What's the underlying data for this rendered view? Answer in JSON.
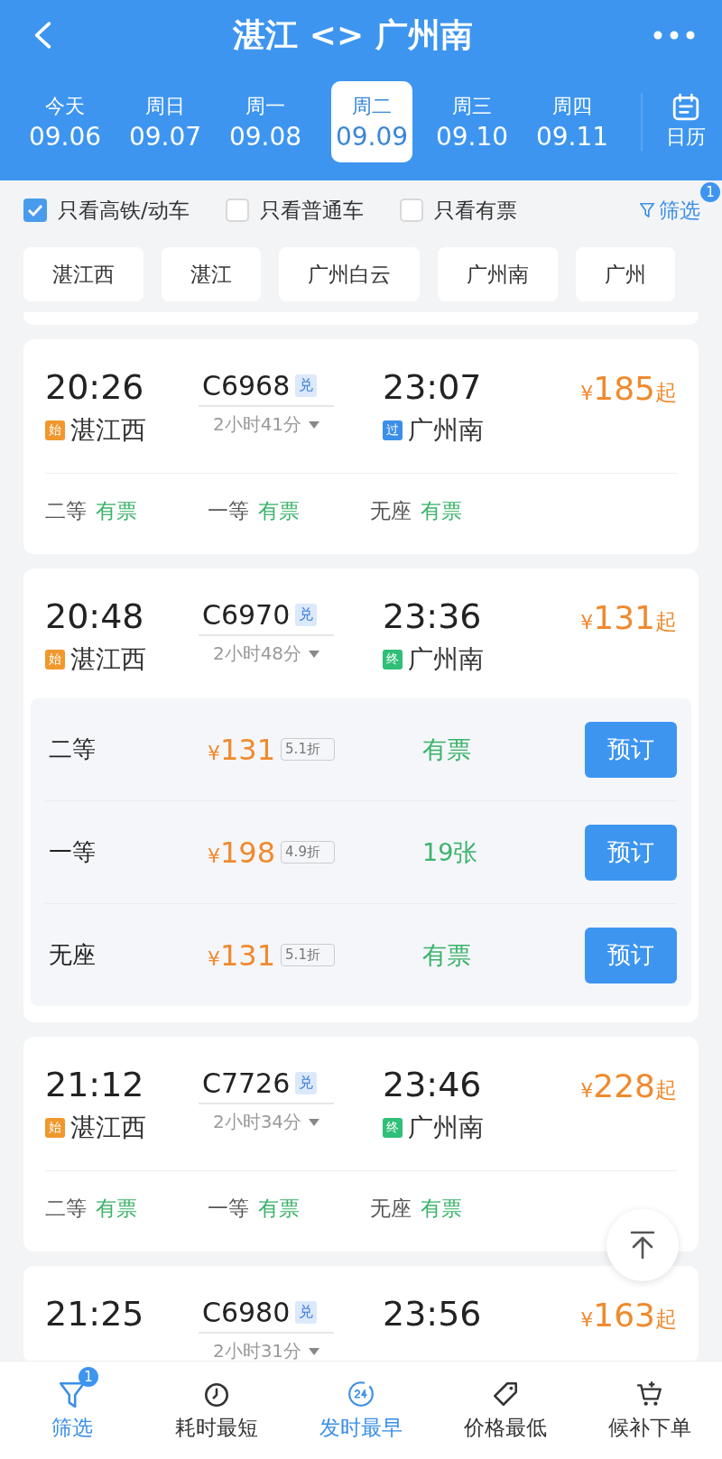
{
  "header": {
    "title": "湛江 <> 广州南"
  },
  "dates": [
    {
      "weekday": "今天",
      "date": "09.06",
      "selected": false
    },
    {
      "weekday": "周日",
      "date": "09.07",
      "selected": false
    },
    {
      "weekday": "周一",
      "date": "09.08",
      "selected": false
    },
    {
      "weekday": "周二",
      "date": "09.09",
      "selected": true
    },
    {
      "weekday": "周三",
      "date": "09.10",
      "selected": false
    },
    {
      "weekday": "周四",
      "date": "09.11",
      "selected": false
    }
  ],
  "calendar": {
    "label": "日历"
  },
  "filters": [
    {
      "label": "只看高铁/动车",
      "checked": true
    },
    {
      "label": "只看普通车",
      "checked": false
    },
    {
      "label": "只看有票",
      "checked": false
    }
  ],
  "filter_button": {
    "label": "筛选",
    "badge": "1"
  },
  "stations": [
    {
      "label": "湛江西"
    },
    {
      "label": "湛江"
    },
    {
      "label": "广州白云"
    },
    {
      "label": "广州南"
    },
    {
      "label": "广州"
    }
  ],
  "trains": [
    {
      "depart_time": "20:26",
      "from": {
        "tag": "始",
        "color": "#f0982e",
        "station": "湛江西"
      },
      "train_no": "C6968",
      "tag": "兑",
      "duration": "2小时41分",
      "arrive_time": "23:07",
      "to": {
        "tag": "过",
        "color": "#3b8fe8",
        "station": "广州南"
      },
      "currency": "¥",
      "price": "185",
      "suffix": "起",
      "expanded": false,
      "seats": [
        {
          "class": "二等",
          "availability": "有票"
        },
        {
          "class": "一等",
          "availability": "有票"
        },
        {
          "class": "无座",
          "availability": "有票"
        }
      ]
    },
    {
      "depart_time": "20:48",
      "from": {
        "tag": "始",
        "color": "#f0982e",
        "station": "湛江西"
      },
      "train_no": "C6970",
      "tag": "兑",
      "duration": "2小时48分",
      "arrive_time": "23:36",
      "to": {
        "tag": "终",
        "color": "#2fbf78",
        "station": "广州南"
      },
      "currency": "¥",
      "price": "131",
      "suffix": "起",
      "expanded": true,
      "seats": [
        {
          "class": "二等",
          "currency": "¥",
          "price": "131",
          "discount": "5.1折",
          "availability": "有票",
          "button": "预订"
        },
        {
          "class": "一等",
          "currency": "¥",
          "price": "198",
          "discount": "4.9折",
          "availability": "19张",
          "button": "预订"
        },
        {
          "class": "无座",
          "currency": "¥",
          "price": "131",
          "discount": "5.1折",
          "availability": "有票",
          "button": "预订"
        }
      ]
    },
    {
      "depart_time": "21:12",
      "from": {
        "tag": "始",
        "color": "#f0982e",
        "station": "湛江西"
      },
      "train_no": "C7726",
      "tag": "兑",
      "duration": "2小时34分",
      "arrive_time": "23:46",
      "to": {
        "tag": "终",
        "color": "#2fbf78",
        "station": "广州南"
      },
      "currency": "¥",
      "price": "228",
      "suffix": "起",
      "expanded": false,
      "seats": [
        {
          "class": "二等",
          "availability": "有票"
        },
        {
          "class": "一等",
          "availability": "有票"
        },
        {
          "class": "无座",
          "availability": "有票"
        }
      ]
    },
    {
      "depart_time": "21:25",
      "train_no": "C6980",
      "tag": "兑",
      "duration": "2小时31分",
      "arrive_time": "23:56",
      "currency": "¥",
      "price": "163",
      "suffix": "起"
    }
  ],
  "bottom_nav": [
    {
      "kind": "filter",
      "label": "筛选",
      "selected": true,
      "badge": "1"
    },
    {
      "kind": "timer",
      "label": "耗时最短",
      "selected": false
    },
    {
      "kind": "clock24",
      "label": "发时最早",
      "selected": true
    },
    {
      "kind": "tag",
      "label": "价格最低",
      "selected": false
    },
    {
      "kind": "cart",
      "label": "候补下单",
      "selected": false
    }
  ]
}
